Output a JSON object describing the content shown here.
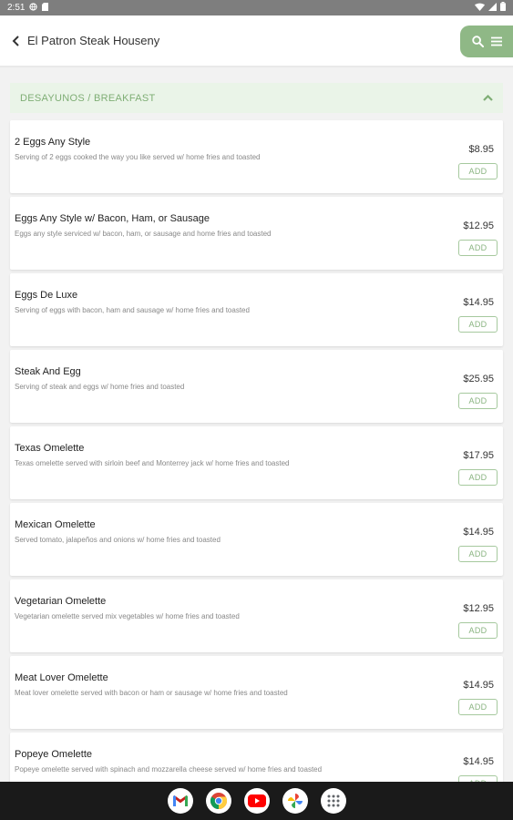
{
  "status_bar": {
    "time": "2:51"
  },
  "header": {
    "title": "El Patron Steak Houseny"
  },
  "category": {
    "label": "DESAYUNOS / BREAKFAST"
  },
  "add_label": "ADD",
  "items": [
    {
      "name": "2 Eggs Any Style",
      "desc": "Serving of 2 eggs cooked the way you like served w/ home fries and toasted",
      "price": "$8.95"
    },
    {
      "name": "Eggs Any Style w/ Bacon, Ham, or Sausage",
      "desc": "Eggs any style serviced w/ bacon, ham, or sausage and home fries and toasted",
      "price": "$12.95"
    },
    {
      "name": "Eggs De Luxe",
      "desc": "Serving of eggs with bacon, ham and sausage w/ home fries and toasted",
      "price": "$14.95"
    },
    {
      "name": "Steak And Egg",
      "desc": "Serving of steak and eggs w/ home fries and toasted",
      "price": "$25.95"
    },
    {
      "name": "Texas Omelette",
      "desc": "Texas omelette served with sirloin beef and Monterrey jack w/ home fries and toasted",
      "price": "$17.95"
    },
    {
      "name": "Mexican Omelette",
      "desc": "Served tomato, jalapeños and onions w/ home fries and toasted",
      "price": "$14.95"
    },
    {
      "name": "Vegetarian Omelette",
      "desc": "Vegetarian omelette served mix vegetables w/ home fries and toasted",
      "price": "$12.95"
    },
    {
      "name": "Meat Lover Omelette",
      "desc": "Meat lover omelette served with bacon or ham or sausage w/ home fries and toasted",
      "price": "$14.95"
    },
    {
      "name": "Popeye Omelette",
      "desc": "Popeye omelette served with spinach and mozzarella cheese served w/ home fries and toasted",
      "price": "$14.95"
    }
  ],
  "nav_apps": [
    "gmail-icon",
    "chrome-icon",
    "youtube-icon",
    "photos-icon",
    "apps-icon"
  ],
  "colors": {
    "accent": "#8fb886",
    "category_bg": "#eaf4e8",
    "category_text": "#7fae75"
  }
}
